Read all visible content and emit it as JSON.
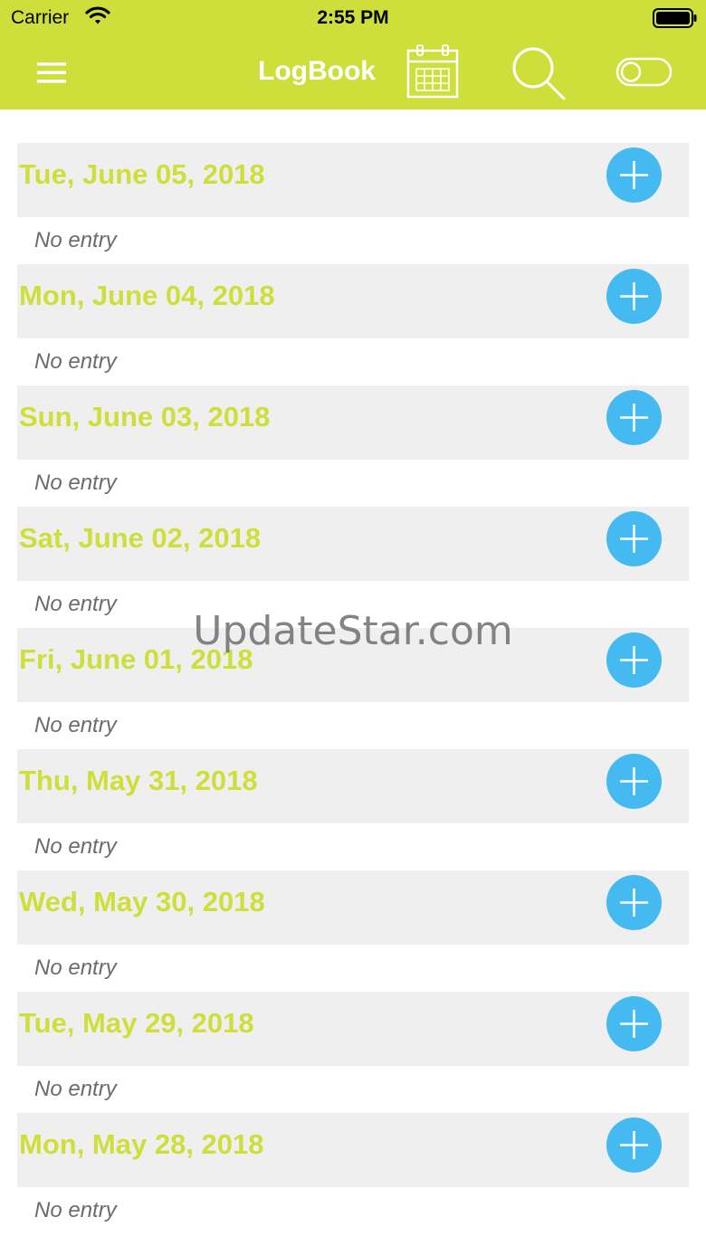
{
  "status_bar": {
    "carrier": "Carrier",
    "time": "2:55 PM"
  },
  "nav": {
    "title": "LogBook",
    "icons": [
      "menu-icon",
      "calendar-icon",
      "search-icon",
      "toggle-icon"
    ]
  },
  "days": [
    {
      "date": "Tue, June 05, 2018",
      "entry": "No entry"
    },
    {
      "date": "Mon, June 04, 2018",
      "entry": "No entry"
    },
    {
      "date": "Sun, June 03, 2018",
      "entry": "No entry"
    },
    {
      "date": "Sat, June 02, 2018",
      "entry": "No entry"
    },
    {
      "date": "Fri, June 01, 2018",
      "entry": "No entry"
    },
    {
      "date": "Thu, May 31, 2018",
      "entry": "No entry"
    },
    {
      "date": "Wed, May 30, 2018",
      "entry": "No entry"
    },
    {
      "date": "Tue, May 29, 2018",
      "entry": "No entry"
    },
    {
      "date": "Mon, May 28, 2018",
      "entry": "No entry"
    }
  ],
  "watermark": "UpdateStar.com",
  "colors": {
    "accent": "#cedf3b",
    "add_button": "#45baf0",
    "header_row": "#efefef",
    "entry_text": "#6b6b6b"
  }
}
